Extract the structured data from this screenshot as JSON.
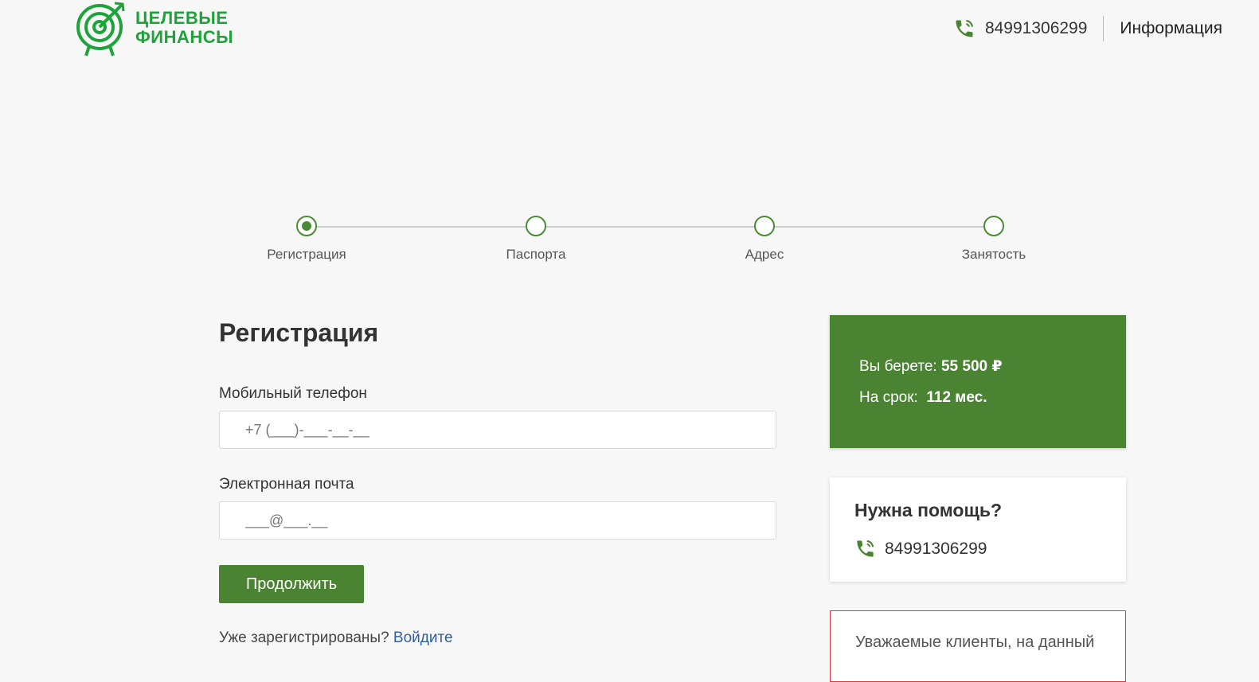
{
  "header": {
    "logo_line1": "ЦЕЛЕВЫЕ",
    "logo_line2": "ФИНАНСЫ",
    "phone": "84991306299",
    "info_link": "Информация"
  },
  "stepper": {
    "steps": [
      {
        "label": "Регистрация",
        "active": true
      },
      {
        "label": "Паспорта",
        "active": false
      },
      {
        "label": "Адрес",
        "active": false
      },
      {
        "label": "Занятость",
        "active": false
      }
    ]
  },
  "form": {
    "title": "Регистрация",
    "phone_label": "Мобильный телефон",
    "phone_placeholder": "+7 (___)-___-__-__",
    "email_label": "Электронная почта",
    "email_placeholder": "___@___.__",
    "continue_label": "Продолжить",
    "already_text": "Уже зарегистрированы?",
    "login_link": "Войдите"
  },
  "loan": {
    "amount_label": "Вы берете:",
    "amount_value": "55 500 ₽",
    "term_label": "На срок:",
    "term_value": "112 мес."
  },
  "help": {
    "title": "Нужна помощь?",
    "phone": "84991306299"
  },
  "notice": {
    "text": "Уважаемые клиенты, на данный"
  },
  "colors": {
    "brand_green": "#1ea33a",
    "accent_green": "#4a8432",
    "notice_border": "#d93a3a",
    "link_blue": "#2b5fa8"
  }
}
